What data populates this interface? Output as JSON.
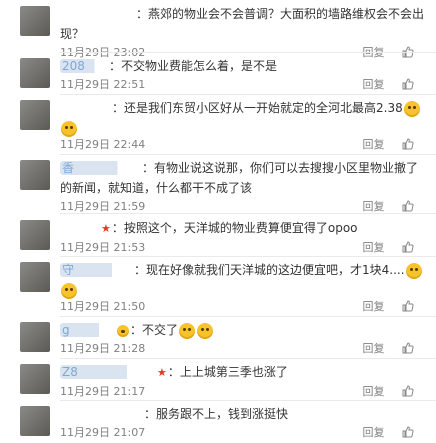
{
  "comments": [
    {
      "user": "",
      "user_blurred": true,
      "text": "：燕郊的物业会不会普调？大面积的墙路维权会不会出现？",
      "time": "11月29日 23:02",
      "reply": "回复"
    },
    {
      "user": "208",
      "user_blurred": true,
      "text": "：不交物业费能怎么着，是不是",
      "time": "11月29日 22:51",
      "reply": "回复"
    },
    {
      "user": "",
      "user_blurred": true,
      "text": "：还是我们东贸小区好从一开始就定的全河北最高2.38",
      "emoji_after": true,
      "time": "11月29日 22:44",
      "reply": "回复"
    },
    {
      "user": "香",
      "user_blurred": true,
      "text": "：有物业说这说那，你们可以去搜搜小区里物业撤了的新闻，就知道，什么都干不成了该",
      "time": "11月29日 21:59",
      "reply": "回复"
    },
    {
      "user": "",
      "user_blurred": true,
      "vip": "★",
      "text": "：按照这个，天洋城的物业费算便宜得了opoo",
      "time": "11月29日 21:53",
      "reply": "回复"
    },
    {
      "user": "守",
      "user_blurred": true,
      "text": "：现在好像就我们天洋城的这边便宜吧，才1块4....",
      "emoji_after": true,
      "time": "11月29日 21:50",
      "reply": "回复"
    },
    {
      "user": "g",
      "user_blurred": true,
      "text": "：不交了",
      "emoji_count": 2,
      "time": "11月29日 21:28",
      "reply": "回复"
    },
    {
      "user": "Z8",
      "user_blurred": true,
      "vip": "★",
      "text": "：上上城第三季也涨了",
      "time": "11月29日 21:17",
      "reply": "回复"
    },
    {
      "user": "",
      "user_blurred": true,
      "text": "：服务跟不上，钱到涨挺快",
      "time": "11月29日 21:07",
      "reply": "回复"
    }
  ]
}
